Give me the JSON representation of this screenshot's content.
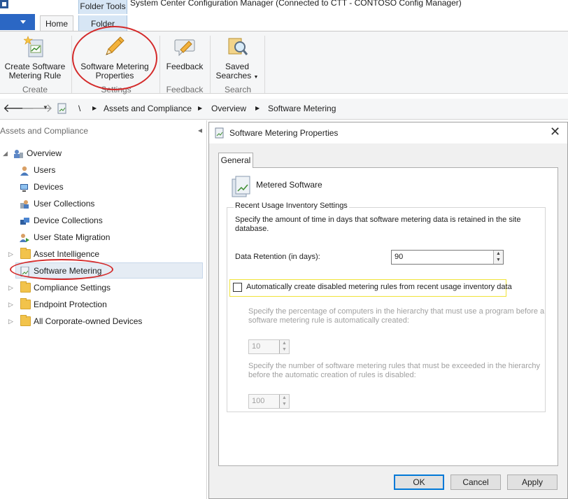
{
  "window": {
    "title": "System Center Configuration Manager (Connected to CTT - CONTOSO Config Manager)",
    "context_tab_group": "Folder Tools"
  },
  "ribbon_tabs": [
    {
      "label": "Home"
    },
    {
      "label": "Folder"
    }
  ],
  "ribbon": {
    "buttons": [
      {
        "label_line1": "Create Software",
        "label_line2": "Metering Rule",
        "icon": "create-rule-icon"
      },
      {
        "label_line1": "Software Metering",
        "label_line2": "Properties",
        "icon": "pencil-icon"
      },
      {
        "label_line1": "Feedback",
        "label_line2": "",
        "icon": "feedback-icon"
      },
      {
        "label_line1": "Saved",
        "label_line2": "Searches",
        "icon": "saved-searches-icon"
      }
    ],
    "groups": [
      "Create",
      "Settings",
      "Feedback",
      "Search"
    ]
  },
  "address_bar": {
    "crumbs": [
      "\\",
      "Assets and Compliance",
      "Overview",
      "Software Metering"
    ]
  },
  "nav": {
    "header": "Assets and Compliance",
    "collapse_glyph": "◂",
    "items": [
      {
        "label": "Overview",
        "icon": "overview-icon"
      },
      {
        "label": "Users",
        "icon": "user-icon"
      },
      {
        "label": "Devices",
        "icon": "device-icon"
      },
      {
        "label": "User Collections",
        "icon": "user-collection-icon"
      },
      {
        "label": "Device Collections",
        "icon": "device-collection-icon"
      },
      {
        "label": "User State Migration",
        "icon": "user-state-migration-icon"
      },
      {
        "label": "Asset Intelligence",
        "icon": "folder-icon"
      },
      {
        "label": "Software Metering",
        "icon": "software-metering-icon"
      },
      {
        "label": "Compliance Settings",
        "icon": "folder-icon"
      },
      {
        "label": "Endpoint Protection",
        "icon": "folder-icon"
      },
      {
        "label": "All Corporate-owned Devices",
        "icon": "folder-icon"
      }
    ]
  },
  "dialog": {
    "title": "Software Metering Properties",
    "tab": "General",
    "heading": "Metered Software",
    "group_title": "Recent Usage Inventory Settings",
    "description_line1": "Specify the amount of time in days that software metering data is retained in the site",
    "description_line2": "database.",
    "retention_label": "Data Retention (in days):",
    "retention_value": "90",
    "auto_create_label": "Automatically create disabled metering rules from recent usage inventory data",
    "percent_desc_line1": "Specify the percentage of computers in the hierarchy that must use a program before a",
    "percent_desc_line2": "software metering rule is automatically created:",
    "percent_value": "10",
    "rules_desc_line1": "Specify the number of software metering rules that must be exceeded in the hierarchy",
    "rules_desc_line2": "before the automatic creation of rules is disabled:",
    "rules_value": "100",
    "buttons": {
      "ok": "OK",
      "cancel": "Cancel",
      "apply": "Apply"
    }
  }
}
